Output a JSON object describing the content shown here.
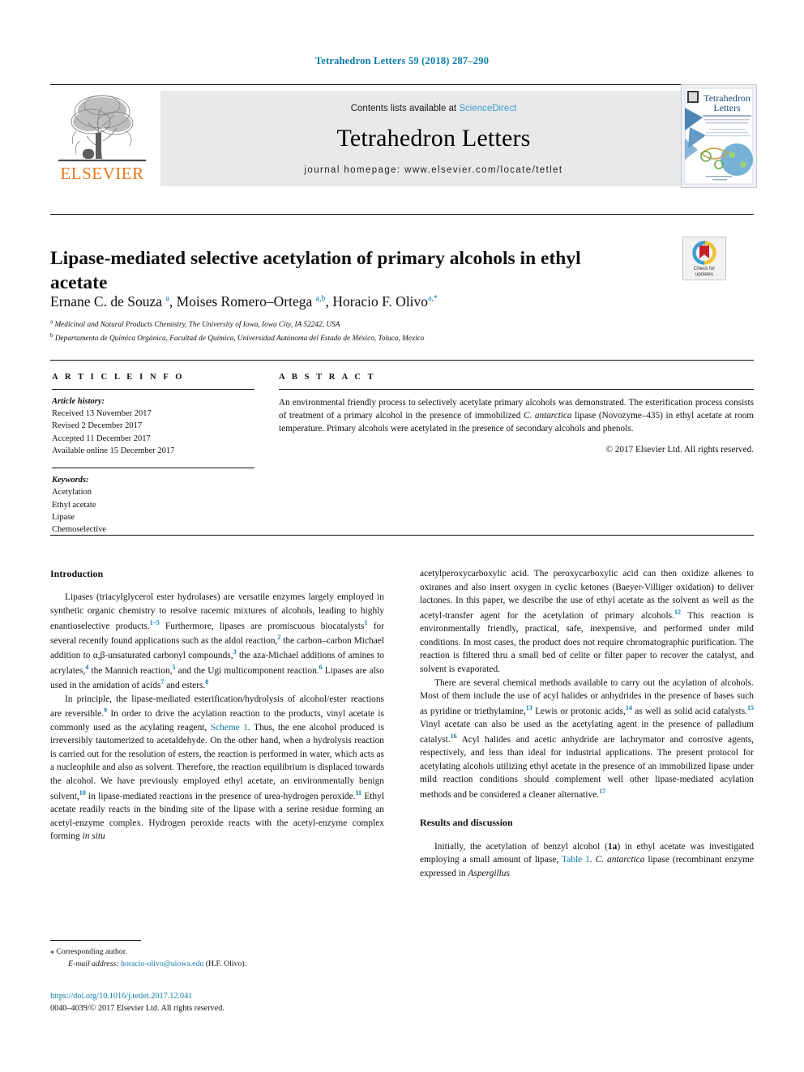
{
  "running_head": "Tetrahedron Letters 59 (2018) 287–290",
  "masthead": {
    "contents_prefix": "Contents lists available at ",
    "sciencedirect": "ScienceDirect",
    "journal_title": "Tetrahedron Letters",
    "homepage": "journal homepage: www.elsevier.com/locate/tetlet",
    "publisher": "ELSEVIER",
    "cover_title_line1": "Tetrahedron",
    "cover_title_line2": "Letters"
  },
  "article": {
    "title": "Lipase-mediated selective acetylation of primary alcohols in ethyl acetate",
    "crossmark_line1": "Check for",
    "crossmark_line2": "updates",
    "authors_html": "Ernane C. de Souza <sup>a</sup>, Moises Romero–Ortega <sup>a,b</sup>, Horacio F. Olivo<sup>a,*</sup>",
    "affiliation_a": "Medicinal and Natural Products Chemistry, The University of Iowa, Iowa City, IA 52242, USA",
    "affiliation_b": "Departamento de Química Orgánica, Facultad de Química, Universidad Autónoma del Estado de México, Toluca, Mexico"
  },
  "info": {
    "heading": "A R T I C L E   I N F O",
    "history_label": "Article history:",
    "history": [
      "Received 13 November 2017",
      "Revised 2 December 2017",
      "Accepted 11 December 2017",
      "Available online 15 December 2017"
    ],
    "keywords_label": "Keywords:",
    "keywords": [
      "Acetylation",
      "Ethyl acetate",
      "Lipase",
      "Chemoselective"
    ]
  },
  "abstract": {
    "heading": "A B S T R A C T",
    "text_html": "An environmental friendly process to selectively acetylate primary alcohols was demonstrated. The esterification process consists of treatment of a primary alcohol in the presence of immobilized <i>C. antarctica</i> lipase (Novozyme–435) in ethyl acetate at room temperature. Primary alcohols were acetylated in the presence of secondary alcohols and phenols.",
    "copyright": "© 2017 Elsevier Ltd. All rights reserved."
  },
  "sections": {
    "introduction_heading": "Introduction",
    "results_heading": "Results and discussion"
  },
  "body": {
    "left_p1_html": "Lipases (triacylglycerol ester hydrolases) are versatile enzymes largely employed in synthetic organic chemistry to resolve racemic mixtures of alcohols, leading to highly enantioselective products.<sup>1–5</sup> Furthermore, lipases are promiscuous biocatalysts<sup>1</sup> for several recently found applications such as the aldol reaction,<sup>2</sup> the carbon–carbon Michael addition to α,β-unsaturated carbonyl compounds,<sup>3</sup> the aza-Michael additions of amines to acrylates,<sup>4</sup> the Mannich reaction,<sup>5</sup> and the Ugi multicomponent reaction.<sup>6</sup> Lipases are also used in the amidation of acids<sup>7</sup> and esters.<sup>8</sup>",
    "left_p2_html": "In principle, the lipase-mediated esterification/hydrolysis of alcohol/ester reactions are reversible.<sup>9</sup> In order to drive the acylation reaction to the products, vinyl acetate is commonly used as the acylating reagent, <span class=\"lnk\">Scheme 1</span>. Thus, the ene alcohol produced is irreversibly tautomerized to acetaldehyde. On the other hand, when a hydrolysis reaction is carried out for the resolution of esters, the reaction is performed in water, which acts as a nucleophile and also as solvent. Therefore, the reaction equilibrium is displaced towards the alcohol. We have previously employed ethyl acetate, an environmentally benign solvent,<sup>10</sup> in lipase-mediated reactions in the presence of urea-hydrogen peroxide.<sup>11</sup> Ethyl acetate readily reacts in the binding site of the lipase with a serine residue forming an acetyl-enzyme complex. Hydrogen peroxide reacts with the acetyl-enzyme complex forming <i>in situ</i>",
    "right_p1_html": "acetylperoxycarboxylic acid. The peroxycarboxylic acid can then oxidize alkenes to oxiranes and also insert oxygen in cyclic ketones (Baeyer-Villiger oxidation) to deliver lactones. In this paper, we describe the use of ethyl acetate as the solvent as well as the acetyl-transfer agent for the acetylation of primary alcohols.<sup>12</sup> This reaction is environmentally friendly, practical, safe, inexpensive, and performed under mild conditions. In most cases, the product does not require chromatographic purification. The reaction is filtered thru a small bed of celite or filter paper to recover the catalyst, and solvent is evaporated.",
    "right_p2_html": "There are several chemical methods available to carry out the acylation of alcohols. Most of them include the use of acyl halides or anhydrides in the presence of bases such as pyridine or triethylamine,<sup>13</sup> Lewis or protonic acids,<sup>14</sup> as well as solid acid catalysts.<sup>15</sup> Vinyl acetate can also be used as the acetylating agent in the presence of palladium catalyst.<sup>16</sup> Acyl halides and acetic anhydride are lachrymator and corrosive agents, respectively, and less than ideal for industrial applications. The present protocol for acetylating alcohols utilizing ethyl acetate in the presence of an immobilized lipase under mild reaction conditions should complement well other lipase-mediated acylation methods and be considered a cleaner alternative.<sup>17</sup>",
    "right_p3_html": "Initially, the acetylation of benzyl alcohol (<b>1a</b>) in ethyl acetate was investigated employing a small amount of lipase, <span class=\"lnk\">Table 1</span>. <i>C. antarctica</i> lipase (recombinant enzyme expressed in <i>Aspergillus</i>"
  },
  "footnote": {
    "corresponding": "⁎  Corresponding author.",
    "email_label": "E-mail address:",
    "email": "horacio-olivo@uiowa.edu",
    "email_suffix": " (H.F. Olivo)."
  },
  "footer": {
    "doi": "https://doi.org/10.1016/j.tetlet.2017.12.041",
    "issn_line": "0040–4039/© 2017 Elsevier Ltd. All rights reserved."
  },
  "colors": {
    "link_blue": "#0b7ba8",
    "sciencedirect_blue": "#3a9bd0",
    "elsevier_orange": "#e8761b",
    "band_grey": "#e9e9e9"
  }
}
